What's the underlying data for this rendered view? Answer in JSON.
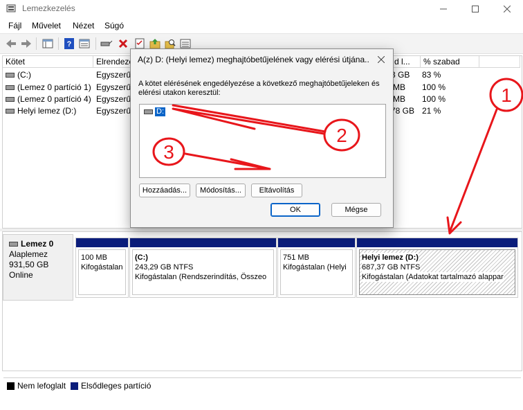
{
  "window": {
    "title": "Lemezkezelés",
    "controls": [
      "minimize-icon",
      "maximize-icon",
      "close-icon"
    ]
  },
  "menu": [
    "Fájl",
    "Művelet",
    "Nézet",
    "Súgó"
  ],
  "toolbar": {
    "icons": [
      "back-arrow-icon",
      "forward-arrow-icon",
      "console-tree-icon",
      "help-icon",
      "properties-icon",
      "connect-icon",
      "delete-icon",
      "checklist-icon",
      "folder-up-icon",
      "search-folder-icon",
      "view-list-icon"
    ],
    "colors": {
      "delete": "#d0181c",
      "folder": "#e8c04b",
      "help": "#1f4fbf"
    }
  },
  "volume_list": {
    "columns": [
      "Kötet",
      "Elrendezé",
      "d l...",
      "% szabad"
    ],
    "rows": [
      {
        "name": "(C:)",
        "layout": "Egyszerű",
        "free": "3 GB",
        "pct": "83 %"
      },
      {
        "name": "(Lemez 0 partíció 1)",
        "layout": "Egyszerű",
        "free": "MB",
        "pct": "100 %"
      },
      {
        "name": "(Lemez 0 partíció 4)",
        "layout": "Egyszerű",
        "free": "MB",
        "pct": "100 %"
      },
      {
        "name": "Helyi lemez (D:)",
        "layout": "Egyszerű",
        "free": "78 GB",
        "pct": "21 %"
      }
    ]
  },
  "disk": {
    "name": "Lemez 0",
    "type": "Alaplemez",
    "size": "931,50 GB",
    "status": "Online",
    "partitions": [
      {
        "title": "",
        "size": "100 MB",
        "state": "Kifogástalan"
      },
      {
        "title": "(C:)",
        "size": "243,29 GB NTFS",
        "state": "Kifogástalan (Rendszerindítás, Összeo"
      },
      {
        "title": "",
        "size": "751 MB",
        "state": "Kifogástalan (Helyi"
      },
      {
        "title": "Helyi lemez  (D:)",
        "size": "687,37 GB NTFS",
        "state": "Kifogástalan (Adatokat tartalmazó alappar"
      }
    ],
    "bar_color": "#0b1d7b"
  },
  "legend": [
    {
      "label": "Nem lefoglalt",
      "color": "#000000"
    },
    {
      "label": "Elsődleges partíció",
      "color": "#0b1d7b"
    }
  ],
  "dialog": {
    "title": "A(z) D: (Helyi lemez) meghajtóbetűjelének vagy elérési útjána...",
    "description": "A kötet elérésének engedélyezése a következő meghajtóbetűjeleken és elérési utakon keresztül:",
    "items": [
      "D:"
    ],
    "buttons": {
      "add": "Hozzáadás...",
      "change": "Módosítás...",
      "remove": "Eltávolítás",
      "ok": "OK",
      "cancel": "Mégse"
    }
  },
  "annotations": {
    "labels": [
      "1",
      "2",
      "3"
    ],
    "color": "#e8161b"
  }
}
